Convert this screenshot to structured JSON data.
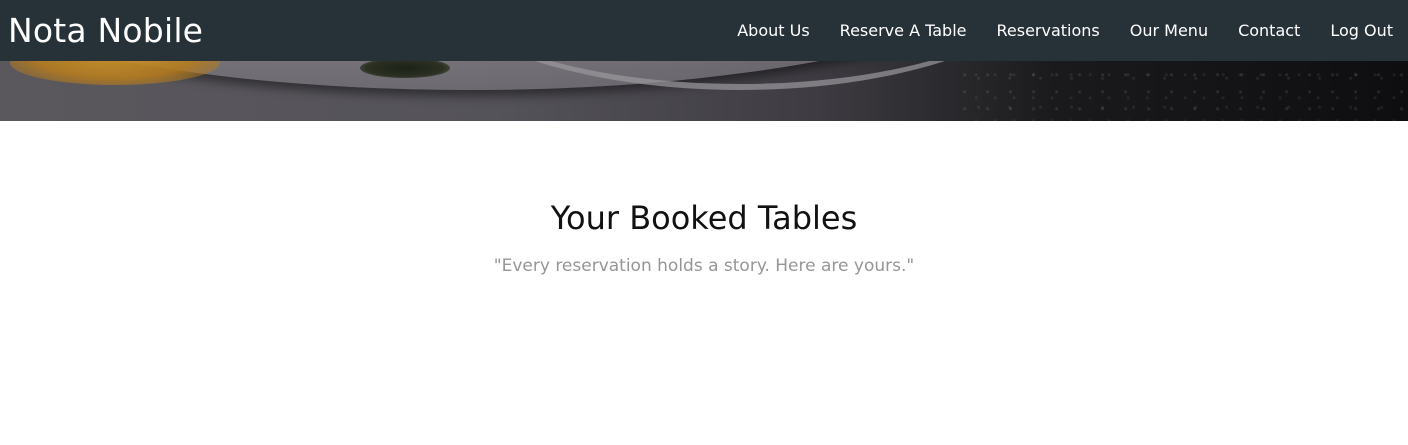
{
  "brand": {
    "name": "Nota Nobile"
  },
  "nav": {
    "items": [
      {
        "label": "About Us"
      },
      {
        "label": "Reserve A Table"
      },
      {
        "label": "Reservations"
      },
      {
        "label": "Our Menu"
      },
      {
        "label": "Contact"
      },
      {
        "label": "Log Out"
      }
    ]
  },
  "main": {
    "title": "Your Booked Tables",
    "subtitle": "\"Every reservation holds a story. Here are yours.\""
  },
  "colors": {
    "navbar_bg": "#263138",
    "nav_text": "#ffffff",
    "title_text": "#111111",
    "subtitle_text": "#969696",
    "page_bg": "#ffffff"
  }
}
